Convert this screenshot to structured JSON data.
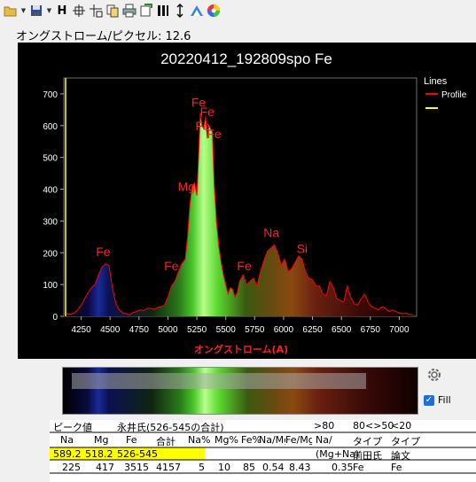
{
  "toolbar": {
    "icons": [
      "open-folder-icon",
      "dropdown-arrow-icon",
      "save-icon",
      "dropdown-arrow-icon",
      "h-icon",
      "crosshair-icon",
      "crosshair-sub-icon",
      "copy-icon",
      "print-icon",
      "export-icon",
      "bars-icon",
      "vertical-arrows-icon",
      "spectrum-icon",
      "color-wheel-icon"
    ],
    "h_label": "H"
  },
  "scale_label": "オングストローム/ピクセル: 12.6",
  "legend": {
    "title": "Lines",
    "entries": [
      {
        "label": "Profile",
        "color": "#ff0000"
      },
      {
        "label": "",
        "color": "#ffff00"
      }
    ]
  },
  "chart_data": {
    "type": "area",
    "title": "20220412_192809spo Fe",
    "xlabel": "オングストローム(A)",
    "ylabel": "",
    "xlim": [
      4100,
      7150
    ],
    "ylim": [
      0,
      750
    ],
    "x_ticks": [
      4250,
      4500,
      4750,
      5000,
      5250,
      5500,
      5750,
      6000,
      6250,
      6500,
      6750,
      7000
    ],
    "y_ticks": [
      0,
      100,
      200,
      300,
      400,
      500,
      600,
      700
    ],
    "series": [
      {
        "color": "#ff0000",
        "x": [
          4100,
          4130,
          4160,
          4190,
          4220,
          4250,
          4280,
          4310,
          4340,
          4370,
          4400,
          4430,
          4460,
          4490,
          4520,
          4550,
          4580,
          4610,
          4640,
          4670,
          4700,
          4730,
          4760,
          4790,
          4820,
          4850,
          4880,
          4910,
          4940,
          4970,
          5000,
          5030,
          5060,
          5090,
          5120,
          5150,
          5170,
          5190,
          5210,
          5230,
          5250,
          5265,
          5280,
          5295,
          5310,
          5325,
          5340,
          5355,
          5370,
          5385,
          5400,
          5420,
          5440,
          5460,
          5480,
          5500,
          5520,
          5540,
          5560,
          5580,
          5600,
          5620,
          5650,
          5680,
          5710,
          5740,
          5770,
          5800,
          5830,
          5860,
          5890,
          5920,
          5950,
          5980,
          6010,
          6040,
          6070,
          6100,
          6130,
          6160,
          6190,
          6220,
          6250,
          6280,
          6310,
          6340,
          6370,
          6400,
          6430,
          6460,
          6490,
          6520,
          6550,
          6580,
          6610,
          6640,
          6670,
          6700,
          6730,
          6760,
          6790,
          6820,
          6850,
          6880,
          6910,
          6940,
          6970,
          7000,
          7030,
          7060,
          7090,
          7120
        ],
        "values": [
          5,
          8,
          6,
          10,
          20,
          35,
          55,
          75,
          90,
          100,
          130,
          155,
          165,
          160,
          90,
          40,
          20,
          10,
          8,
          5,
          12,
          15,
          20,
          18,
          25,
          25,
          22,
          28,
          30,
          35,
          60,
          95,
          110,
          140,
          165,
          180,
          250,
          350,
          410,
          420,
          380,
          500,
          640,
          600,
          590,
          630,
          560,
          600,
          590,
          580,
          420,
          300,
          220,
          170,
          130,
          100,
          70,
          90,
          85,
          60,
          75,
          110,
          130,
          100,
          110,
          120,
          95,
          140,
          175,
          205,
          215,
          225,
          200,
          160,
          180,
          140,
          150,
          170,
          190,
          180,
          140,
          120,
          115,
          95,
          95,
          70,
          65,
          110,
          90,
          55,
          50,
          45,
          95,
          60,
          40,
          35,
          55,
          70,
          45,
          30,
          25,
          20,
          30,
          25,
          15,
          20,
          15,
          10,
          8,
          10,
          5,
          5
        ]
      }
    ],
    "annotations": [
      {
        "label": "Fe",
        "x": 4440,
        "y": 190
      },
      {
        "label": "Fe",
        "x": 5030,
        "y": 145
      },
      {
        "label": "Mg",
        "x": 5160,
        "y": 395
      },
      {
        "label": "Fe",
        "x": 5265,
        "y": 660
      },
      {
        "label": "Fe",
        "x": 5300,
        "y": 585
      },
      {
        "label": "Fe",
        "x": 5340,
        "y": 630
      },
      {
        "label": "Fe",
        "x": 5400,
        "y": 560
      },
      {
        "label": "Fe",
        "x": 5660,
        "y": 145
      },
      {
        "label": "Na",
        "x": 5895,
        "y": 250
      },
      {
        "label": "Si",
        "x": 6160,
        "y": 200
      }
    ],
    "marker_line": {
      "color": "#ffff00"
    }
  },
  "fill": {
    "label": "Fill",
    "checked": true
  },
  "table": {
    "row0": [
      "ピーク値",
      "永井氏(526-545の合計)",
      ">80",
      "80<>50",
      "<20"
    ],
    "headers": [
      "Na",
      "Mg",
      "Fe",
      "合計",
      "Na%",
      "Mg%",
      "Fe%",
      "Na/Mg",
      "Fe/Mg",
      "Na/",
      "タイプ",
      "タイプ"
    ],
    "row_yellow": [
      "589.2",
      "518.2",
      "526-545"
    ],
    "row_yellow_extra": [
      "(Mg+Na)",
      "前田氏",
      "論文"
    ],
    "row_values": [
      "225",
      "417",
      "3515",
      "4157",
      "5",
      "10",
      "85",
      "0.54",
      "8.43",
      "0.35",
      "Fe",
      "Fe"
    ]
  }
}
